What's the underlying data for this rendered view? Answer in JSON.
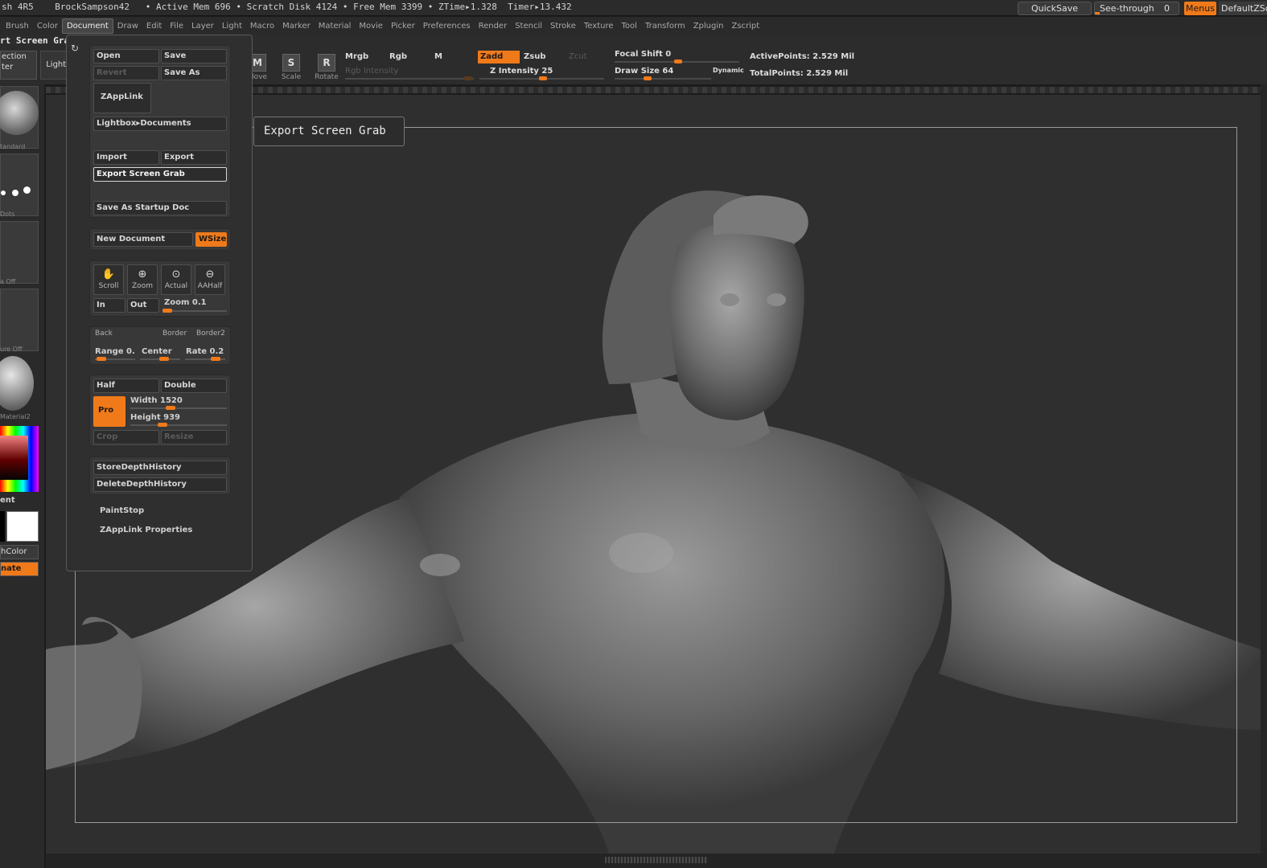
{
  "status": {
    "text": "sh 4R5    BrockSampson42   • Active Mem 696 • Scratch Disk 4124 • Free Mem 3399 • ZTime▸1.328  Timer▸13.432",
    "quicksave": "QuickSave",
    "see_through_label": "See-through",
    "see_through_value": "0",
    "menus": "Menus",
    "default_zscript": "DefaultZScript"
  },
  "menubar": {
    "items": [
      "Brush",
      "Color",
      "Document",
      "Draw",
      "Edit",
      "File",
      "Layer",
      "Light",
      "Macro",
      "Marker",
      "Material",
      "Movie",
      "Picker",
      "Preferences",
      "Render",
      "Stencil",
      "Stroke",
      "Texture",
      "Tool",
      "Transform",
      "Zplugin",
      "Zscript"
    ],
    "active": "Document"
  },
  "left": {
    "palette_title": "rt Screen Grab",
    "projection_line1": "ection",
    "projection_line2": "ter",
    "lightbox": "LightBox",
    "thumbs": [
      "tandard",
      "Dots",
      "a  Off",
      "ure  Off",
      "Material2"
    ],
    "gradient": "ent",
    "switch_color": "hColor",
    "alternate": "nate"
  },
  "toolbar": {
    "move": "Move",
    "scale": "Scale",
    "rotate": "Rotate",
    "mrgb": "Mrgb",
    "rgb": "Rgb",
    "m": "M",
    "zadd": "Zadd",
    "zsub": "Zsub",
    "zcut": "Zcut",
    "rgb_intensity": "Rgb  Intensity",
    "z_intensity": "Z  Intensity 25",
    "focal_shift": "Focal  Shift 0",
    "draw_size": "Draw  Size 64",
    "dynamic": "Dynamic",
    "active_points": "ActivePoints: 2.529  Mil",
    "total_points": "TotalPoints: 2.529  Mil"
  },
  "document": {
    "open": "Open",
    "save": "Save",
    "revert": "Revert",
    "save_as": "Save  As",
    "zapplink": "ZAppLink",
    "lightbox_documents": "Lightbox▸Documents",
    "import": "Import",
    "export": "Export",
    "export_screen_grab": "Export  Screen  Grab",
    "save_startup": "Save  As  Startup  Doc",
    "new_document": "New  Document",
    "wsize": "WSize",
    "scroll": "Scroll",
    "zoom": "Zoom",
    "actual": "Actual",
    "aahalf": "AAHalf",
    "in": "In",
    "out": "Out",
    "zoom_value": "Zoom 0.1",
    "back": "Back",
    "border": "Border",
    "border2": "Border2",
    "range": "Range 0.",
    "center": "Center",
    "rate": "Rate 0.2",
    "half": "Half",
    "double": "Double",
    "pro": "Pro",
    "width": "Width 1520",
    "height": "Height 939",
    "crop": "Crop",
    "resize": "Resize",
    "store_depth": "StoreDepthHistory",
    "delete_depth": "DeleteDepthHistory",
    "paintstop": "PaintStop",
    "zapplink_props": "ZAppLink  Properties"
  },
  "tooltip": "Export Screen Grab",
  "colors": {
    "accent": "#f07a1a",
    "canvas": "#2f2f2f"
  }
}
